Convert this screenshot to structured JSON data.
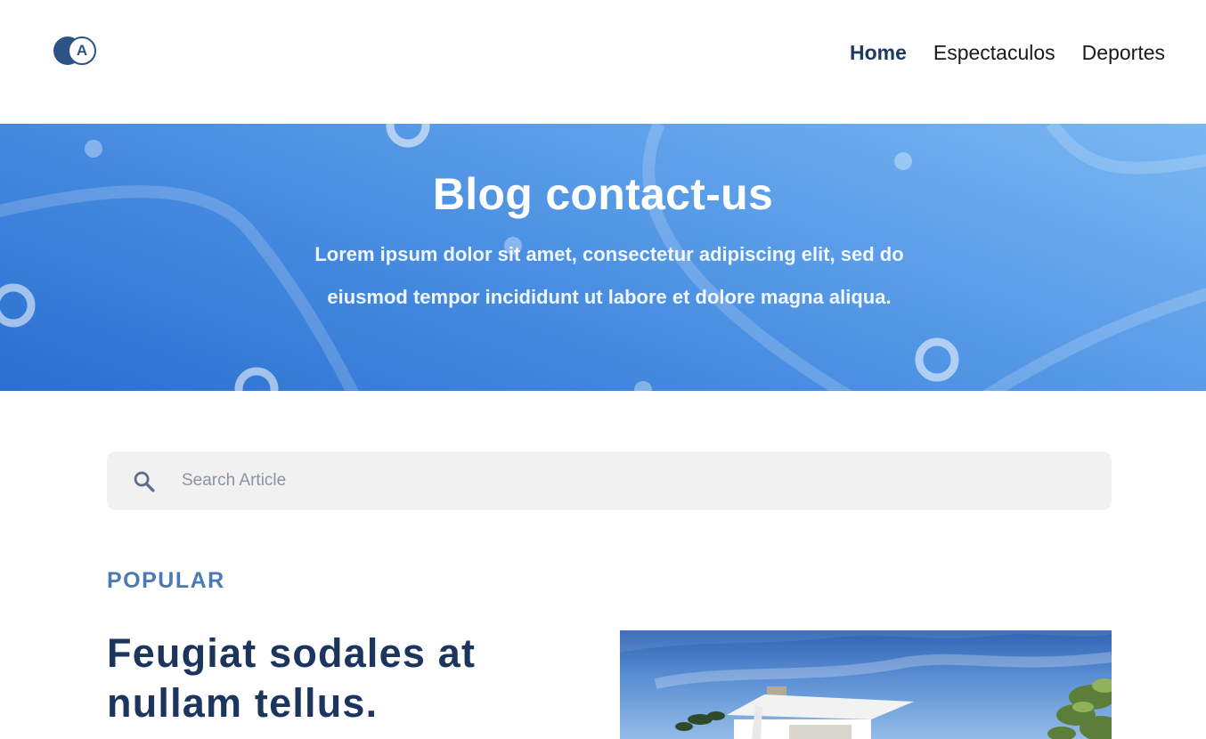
{
  "header": {
    "logo_letter": "A",
    "nav": [
      {
        "label": "Home",
        "active": true
      },
      {
        "label": "Espectaculos",
        "active": false
      },
      {
        "label": "Deportes",
        "active": false
      }
    ]
  },
  "hero": {
    "title": "Blog contact-us",
    "subtitle": "Lorem ipsum dolor sit amet, consectetur adipiscing elit, sed do eiusmod tempor incididunt ut labore et dolore magna aliqua."
  },
  "search": {
    "placeholder": "Search Article",
    "value": "",
    "icon": "search-icon"
  },
  "popular": {
    "label": "POPULAR",
    "article_title": "Feugiat sodales at nullam tellus."
  },
  "colors": {
    "nav_active": "#1e3a63",
    "hero_start": "#2a6fd0",
    "hero_end": "#7ab7f3",
    "section_label": "#4a7ab5",
    "article_title": "#1c355e"
  }
}
